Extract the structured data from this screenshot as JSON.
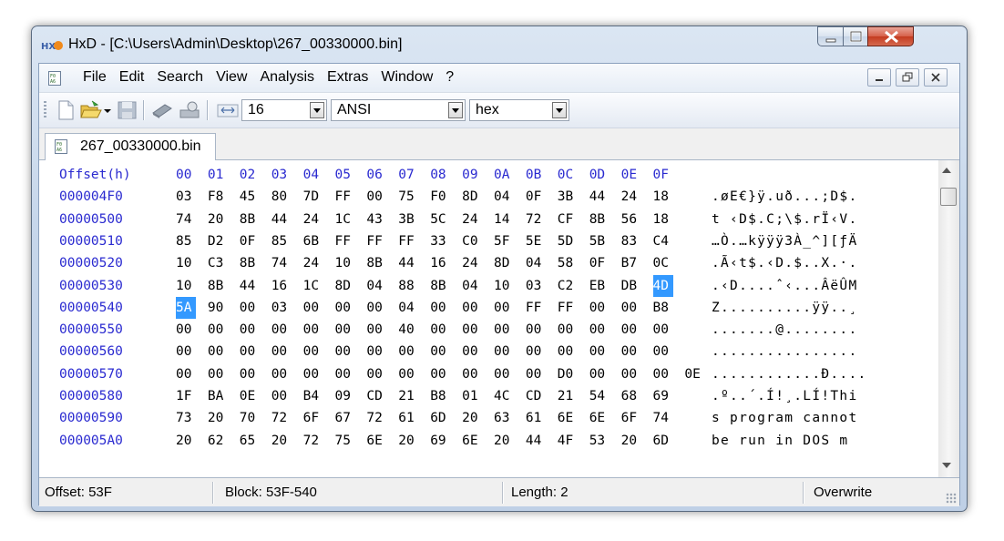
{
  "window": {
    "title": "HxD - [C:\\Users\\Admin\\Desktop\\267_00330000.bin]"
  },
  "menu": [
    "File",
    "Edit",
    "Search",
    "View",
    "Analysis",
    "Extras",
    "Window",
    "?"
  ],
  "toolbar": {
    "bytes_per_row": "16",
    "charset": "ANSI",
    "offset_base": "hex"
  },
  "tab": {
    "label": "267_00330000.bin"
  },
  "hexview": {
    "offset_header": "Offset(h)",
    "column_headers": [
      "00",
      "01",
      "02",
      "03",
      "04",
      "05",
      "06",
      "07",
      "08",
      "09",
      "0A",
      "0B",
      "0C",
      "0D",
      "0E",
      "0F"
    ],
    "rows": [
      {
        "offset": "000004F0",
        "bytes": [
          "03",
          "F8",
          "45",
          "80",
          "7D",
          "FF",
          "00",
          "75",
          "F0",
          "8D",
          "04",
          "0F",
          "3B",
          "44",
          "24",
          "18"
        ],
        "ascii": ".øE€}ÿ.uð...;D$."
      },
      {
        "offset": "00000500",
        "bytes": [
          "74",
          "20",
          "8B",
          "44",
          "24",
          "1C",
          "43",
          "3B",
          "5C",
          "24",
          "14",
          "72",
          "CF",
          "8B",
          "56",
          "18"
        ],
        "ascii": "t ‹D$.C;\\$.rÏ‹V."
      },
      {
        "offset": "00000510",
        "bytes": [
          "85",
          "D2",
          "0F",
          "85",
          "6B",
          "FF",
          "FF",
          "FF",
          "33",
          "C0",
          "5F",
          "5E",
          "5D",
          "5B",
          "83",
          "C4"
        ],
        "ascii": "…Ò.…kÿÿÿ3À_^][ƒÄ"
      },
      {
        "offset": "00000520",
        "bytes": [
          "10",
          "C3",
          "8B",
          "74",
          "24",
          "10",
          "8B",
          "44",
          "16",
          "24",
          "8D",
          "04",
          "58",
          "0F",
          "B7",
          "0C"
        ],
        "ascii": ".Ã‹t$.‹D.$..X.·."
      },
      {
        "offset": "00000530",
        "bytes": [
          "10",
          "8B",
          "44",
          "16",
          "1C",
          "8D",
          "04",
          "88",
          "8B",
          "04",
          "10",
          "03",
          "C2",
          "EB",
          "DB",
          "4D"
        ],
        "ascii": ".‹D....ˆ‹...ÂëÛM"
      },
      {
        "offset": "00000540",
        "bytes": [
          "5A",
          "90",
          "00",
          "03",
          "00",
          "00",
          "00",
          "04",
          "00",
          "00",
          "00",
          "FF",
          "FF",
          "00",
          "00",
          "B8"
        ],
        "ascii": "Z..........ÿÿ..¸"
      },
      {
        "offset": "00000550",
        "bytes": [
          "00",
          "00",
          "00",
          "00",
          "00",
          "00",
          "00",
          "40",
          "00",
          "00",
          "00",
          "00",
          "00",
          "00",
          "00",
          "00"
        ],
        "ascii": ".......@........"
      },
      {
        "offset": "00000560",
        "bytes": [
          "00",
          "00",
          "00",
          "00",
          "00",
          "00",
          "00",
          "00",
          "00",
          "00",
          "00",
          "00",
          "00",
          "00",
          "00",
          "00"
        ],
        "ascii": "................"
      },
      {
        "offset": "00000570",
        "bytes": [
          "00",
          "00",
          "00",
          "00",
          "00",
          "00",
          "00",
          "00",
          "00",
          "00",
          "00",
          "00",
          "D0",
          "00",
          "00",
          "00",
          "0E"
        ],
        "ascii": "............Ð...."
      },
      {
        "offset": "00000580",
        "bytes": [
          "1F",
          "BA",
          "0E",
          "00",
          "B4",
          "09",
          "CD",
          "21",
          "B8",
          "01",
          "4C",
          "CD",
          "21",
          "54",
          "68",
          "69"
        ],
        "ascii": ".º..´.Í!¸.LÍ!Thi"
      },
      {
        "offset": "00000590",
        "bytes": [
          "73",
          "20",
          "70",
          "72",
          "6F",
          "67",
          "72",
          "61",
          "6D",
          "20",
          "63",
          "61",
          "6E",
          "6E",
          "6F",
          "74"
        ],
        "ascii": "s program cannot"
      },
      {
        "offset": "000005A0",
        "bytes": [
          "20",
          "62",
          "65",
          "20",
          "72",
          "75",
          "6E",
          "20",
          "69",
          "6E",
          "20",
          "44",
          "4F",
          "53",
          "20",
          "6D"
        ],
        "ascii": " be run in DOS m"
      }
    ]
  },
  "status": {
    "offset": "Offset: 53F",
    "block": "Block: 53F-540",
    "length": "Length: 2",
    "mode": "Overwrite"
  },
  "colors": {
    "selection": "#3399ff",
    "offset_text": "#2a2ad0"
  }
}
